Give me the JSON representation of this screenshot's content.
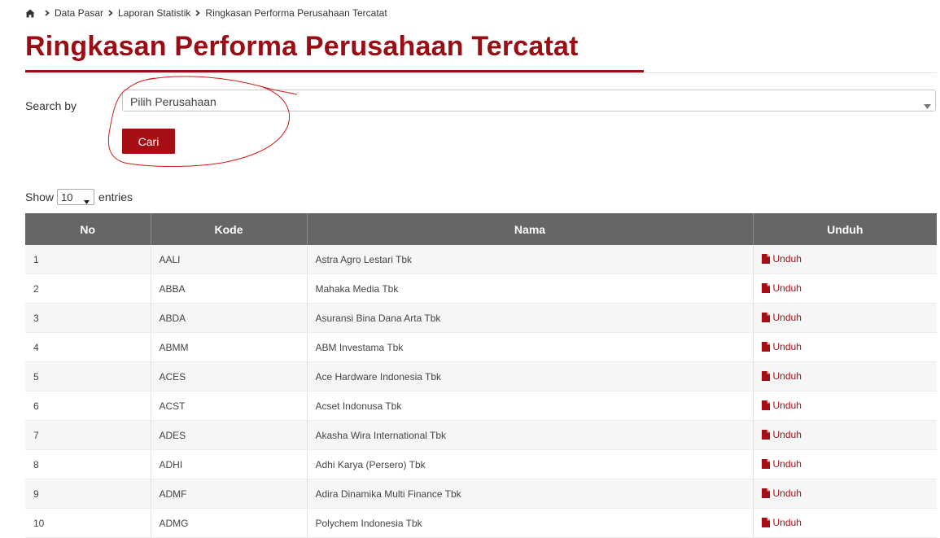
{
  "breadcrumb": {
    "items": [
      "Data Pasar",
      "Laporan Statistik",
      "Ringkasan Performa Perusahaan Tercatat"
    ]
  },
  "page": {
    "title": "Ringkasan Performa Perusahaan Tercatat"
  },
  "search": {
    "label": "Search by",
    "placeholder": "Pilih Perusahaan",
    "button_label": "Cari"
  },
  "table_controls": {
    "show_label": "Show",
    "entries_value": "10",
    "entries_label": "entries"
  },
  "table": {
    "columns": [
      "No",
      "Kode",
      "Nama",
      "Unduh"
    ],
    "rows": [
      {
        "no": "1",
        "kode": "AALI",
        "nama": "Astra Agro Lestari Tbk",
        "unduh": "Unduh"
      },
      {
        "no": "2",
        "kode": "ABBA",
        "nama": "Mahaka Media Tbk",
        "unduh": "Unduh"
      },
      {
        "no": "3",
        "kode": "ABDA",
        "nama": "Asuransi Bina Dana Arta Tbk",
        "unduh": "Unduh"
      },
      {
        "no": "4",
        "kode": "ABMM",
        "nama": "ABM Investama Tbk",
        "unduh": "Unduh"
      },
      {
        "no": "5",
        "kode": "ACES",
        "nama": "Ace Hardware Indonesia Tbk",
        "unduh": "Unduh"
      },
      {
        "no": "6",
        "kode": "ACST",
        "nama": "Acset Indonusa Tbk",
        "unduh": "Unduh"
      },
      {
        "no": "7",
        "kode": "ADES",
        "nama": "Akasha Wira International Tbk",
        "unduh": "Unduh"
      },
      {
        "no": "8",
        "kode": "ADHI",
        "nama": "Adhi Karya (Persero) Tbk",
        "unduh": "Unduh"
      },
      {
        "no": "9",
        "kode": "ADMF",
        "nama": "Adira Dinamika Multi Finance Tbk",
        "unduh": "Unduh"
      },
      {
        "no": "10",
        "kode": "ADMG",
        "nama": "Polychem Indonesia Tbk",
        "unduh": "Unduh"
      }
    ]
  },
  "icons": {
    "home": "home-icon",
    "separator": "chevron-right-icon",
    "dropdown": "caret-down-icon",
    "file": "pdf-file-icon"
  },
  "colors": {
    "brand": "#9b0d14",
    "button": "#a50f14",
    "table_header": "#666666",
    "annotation": "#d11a1a"
  }
}
